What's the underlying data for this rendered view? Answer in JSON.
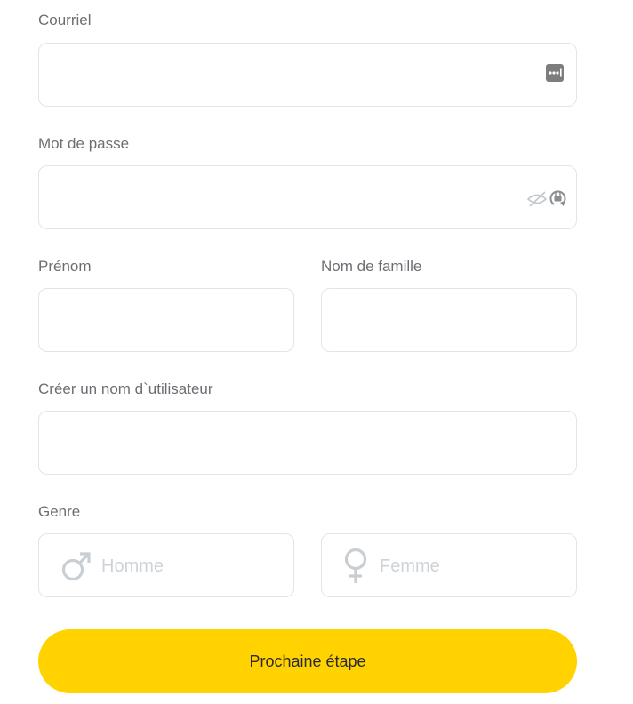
{
  "form": {
    "email": {
      "label": "Courriel",
      "value": "",
      "icon": "password-manager-icon"
    },
    "password": {
      "label": "Mot de passe",
      "value": "",
      "icon": "hidden-password-lock-icon"
    },
    "first_name": {
      "label": "Prénom",
      "value": ""
    },
    "last_name": {
      "label": "Nom de famille",
      "value": ""
    },
    "username": {
      "label": "Créer un nom d`utilisateur",
      "value": ""
    },
    "gender": {
      "label": "Genre",
      "options": [
        {
          "label": "Homme",
          "icon": "male-symbol-icon"
        },
        {
          "label": "Femme",
          "icon": "female-symbol-icon"
        }
      ]
    },
    "next_button": {
      "label": "Prochaine étape"
    }
  },
  "colors": {
    "accent": "#ffd200",
    "border": "#e3e4e6",
    "label_text": "#6b6f73",
    "placeholder": "#cdd3d8"
  }
}
